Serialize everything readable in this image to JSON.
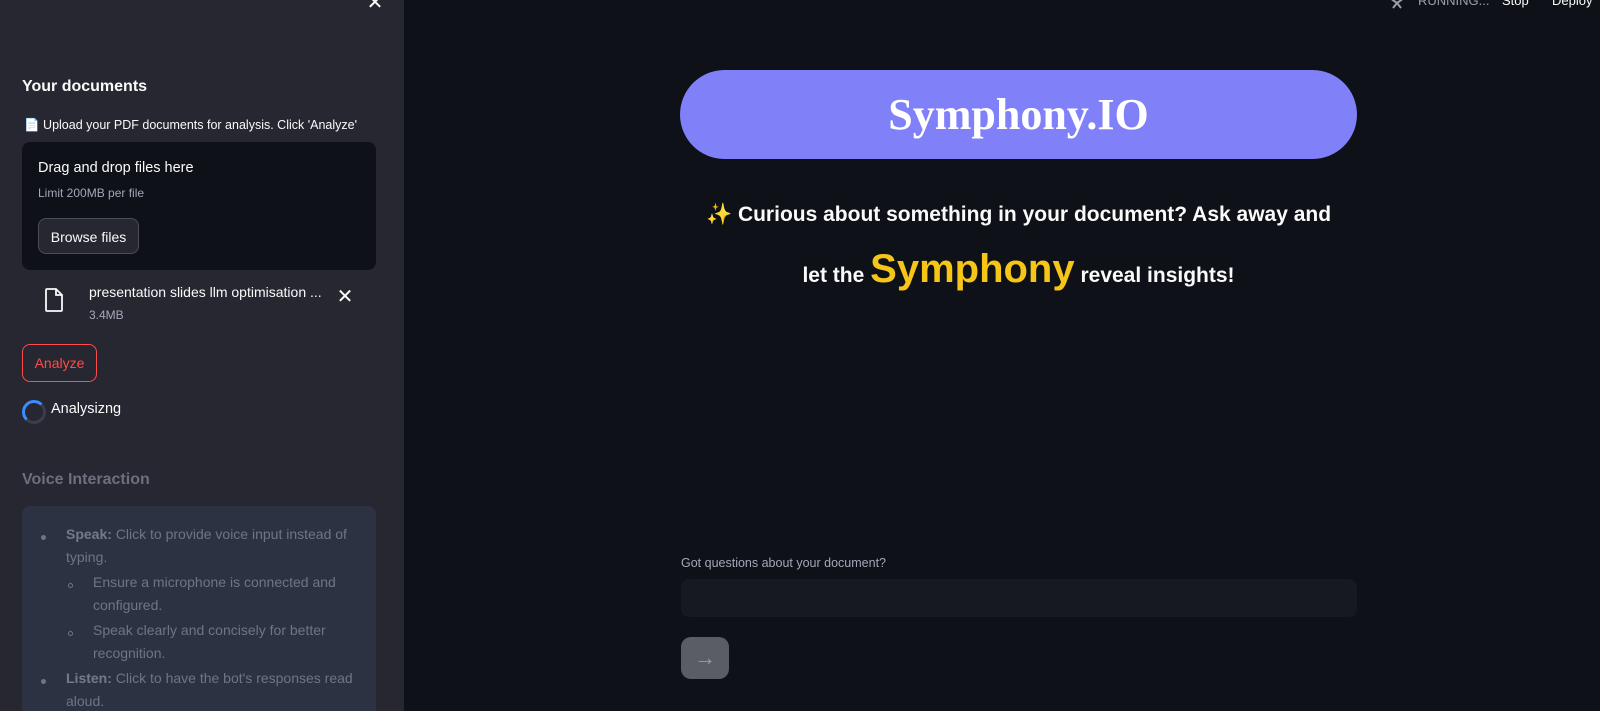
{
  "header": {
    "status": "RUNNING...",
    "stop_label": "Stop",
    "deploy_label": "Deploy"
  },
  "sidebar": {
    "close_icon": "close-icon",
    "title": "Your documents",
    "subtitle": "📄 Upload your PDF documents for analysis. Click 'Analyze'",
    "dropzone": {
      "title": "Drag and drop files here",
      "limit": "Limit 200MB per file",
      "browse_label": "Browse files"
    },
    "file": {
      "name": "presentation slides llm optimisation ...",
      "size": "3.4MB"
    },
    "analyze_label": "Analyze",
    "status_text": "Analysizng",
    "voice_title": "Voice Interaction",
    "voice_info": {
      "speak_label": "Speak:",
      "speak_text": "Click to provide voice input instead of",
      "speak_text2": "typing.",
      "sub1_line1": "Ensure a microphone is connected and",
      "sub1_line2": "configured.",
      "sub2_line1": "Speak clearly and concisely for better",
      "sub2_line2": "recognition.",
      "listen_label": "Listen:",
      "listen_text": "Click to have the bot's responses read",
      "listen_text2": "aloud."
    }
  },
  "main": {
    "app_title": "Symphony.IO",
    "tagline_sparkle": "✨",
    "tagline_line1": "Curious about something in your document? Ask away and",
    "tagline_pre": "let the",
    "tagline_highlight": "Symphony",
    "tagline_post": "reveal insights!",
    "question_label": "Got questions about your document?",
    "question_value": "",
    "send_icon": "arrow-right-icon"
  },
  "colors": {
    "background": "#0e1117",
    "sidebar": "#262730",
    "title_pill": "#8080f8",
    "highlight": "#f5c518",
    "analyze": "#ff4b4b"
  }
}
